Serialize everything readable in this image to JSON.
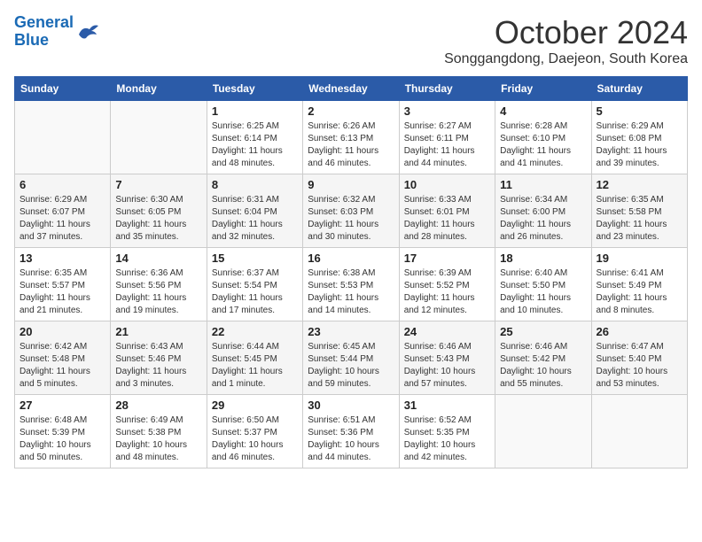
{
  "logo": {
    "line1": "General",
    "line2": "Blue"
  },
  "title": "October 2024",
  "subtitle": "Songgangdong, Daejeon, South Korea",
  "days_header": [
    "Sunday",
    "Monday",
    "Tuesday",
    "Wednesday",
    "Thursday",
    "Friday",
    "Saturday"
  ],
  "weeks": [
    [
      {
        "num": "",
        "info": ""
      },
      {
        "num": "",
        "info": ""
      },
      {
        "num": "1",
        "info": "Sunrise: 6:25 AM\nSunset: 6:14 PM\nDaylight: 11 hours and 48 minutes."
      },
      {
        "num": "2",
        "info": "Sunrise: 6:26 AM\nSunset: 6:13 PM\nDaylight: 11 hours and 46 minutes."
      },
      {
        "num": "3",
        "info": "Sunrise: 6:27 AM\nSunset: 6:11 PM\nDaylight: 11 hours and 44 minutes."
      },
      {
        "num": "4",
        "info": "Sunrise: 6:28 AM\nSunset: 6:10 PM\nDaylight: 11 hours and 41 minutes."
      },
      {
        "num": "5",
        "info": "Sunrise: 6:29 AM\nSunset: 6:08 PM\nDaylight: 11 hours and 39 minutes."
      }
    ],
    [
      {
        "num": "6",
        "info": "Sunrise: 6:29 AM\nSunset: 6:07 PM\nDaylight: 11 hours and 37 minutes."
      },
      {
        "num": "7",
        "info": "Sunrise: 6:30 AM\nSunset: 6:05 PM\nDaylight: 11 hours and 35 minutes."
      },
      {
        "num": "8",
        "info": "Sunrise: 6:31 AM\nSunset: 6:04 PM\nDaylight: 11 hours and 32 minutes."
      },
      {
        "num": "9",
        "info": "Sunrise: 6:32 AM\nSunset: 6:03 PM\nDaylight: 11 hours and 30 minutes."
      },
      {
        "num": "10",
        "info": "Sunrise: 6:33 AM\nSunset: 6:01 PM\nDaylight: 11 hours and 28 minutes."
      },
      {
        "num": "11",
        "info": "Sunrise: 6:34 AM\nSunset: 6:00 PM\nDaylight: 11 hours and 26 minutes."
      },
      {
        "num": "12",
        "info": "Sunrise: 6:35 AM\nSunset: 5:58 PM\nDaylight: 11 hours and 23 minutes."
      }
    ],
    [
      {
        "num": "13",
        "info": "Sunrise: 6:35 AM\nSunset: 5:57 PM\nDaylight: 11 hours and 21 minutes."
      },
      {
        "num": "14",
        "info": "Sunrise: 6:36 AM\nSunset: 5:56 PM\nDaylight: 11 hours and 19 minutes."
      },
      {
        "num": "15",
        "info": "Sunrise: 6:37 AM\nSunset: 5:54 PM\nDaylight: 11 hours and 17 minutes."
      },
      {
        "num": "16",
        "info": "Sunrise: 6:38 AM\nSunset: 5:53 PM\nDaylight: 11 hours and 14 minutes."
      },
      {
        "num": "17",
        "info": "Sunrise: 6:39 AM\nSunset: 5:52 PM\nDaylight: 11 hours and 12 minutes."
      },
      {
        "num": "18",
        "info": "Sunrise: 6:40 AM\nSunset: 5:50 PM\nDaylight: 11 hours and 10 minutes."
      },
      {
        "num": "19",
        "info": "Sunrise: 6:41 AM\nSunset: 5:49 PM\nDaylight: 11 hours and 8 minutes."
      }
    ],
    [
      {
        "num": "20",
        "info": "Sunrise: 6:42 AM\nSunset: 5:48 PM\nDaylight: 11 hours and 5 minutes."
      },
      {
        "num": "21",
        "info": "Sunrise: 6:43 AM\nSunset: 5:46 PM\nDaylight: 11 hours and 3 minutes."
      },
      {
        "num": "22",
        "info": "Sunrise: 6:44 AM\nSunset: 5:45 PM\nDaylight: 11 hours and 1 minute."
      },
      {
        "num": "23",
        "info": "Sunrise: 6:45 AM\nSunset: 5:44 PM\nDaylight: 10 hours and 59 minutes."
      },
      {
        "num": "24",
        "info": "Sunrise: 6:46 AM\nSunset: 5:43 PM\nDaylight: 10 hours and 57 minutes."
      },
      {
        "num": "25",
        "info": "Sunrise: 6:46 AM\nSunset: 5:42 PM\nDaylight: 10 hours and 55 minutes."
      },
      {
        "num": "26",
        "info": "Sunrise: 6:47 AM\nSunset: 5:40 PM\nDaylight: 10 hours and 53 minutes."
      }
    ],
    [
      {
        "num": "27",
        "info": "Sunrise: 6:48 AM\nSunset: 5:39 PM\nDaylight: 10 hours and 50 minutes."
      },
      {
        "num": "28",
        "info": "Sunrise: 6:49 AM\nSunset: 5:38 PM\nDaylight: 10 hours and 48 minutes."
      },
      {
        "num": "29",
        "info": "Sunrise: 6:50 AM\nSunset: 5:37 PM\nDaylight: 10 hours and 46 minutes."
      },
      {
        "num": "30",
        "info": "Sunrise: 6:51 AM\nSunset: 5:36 PM\nDaylight: 10 hours and 44 minutes."
      },
      {
        "num": "31",
        "info": "Sunrise: 6:52 AM\nSunset: 5:35 PM\nDaylight: 10 hours and 42 minutes."
      },
      {
        "num": "",
        "info": ""
      },
      {
        "num": "",
        "info": ""
      }
    ]
  ]
}
